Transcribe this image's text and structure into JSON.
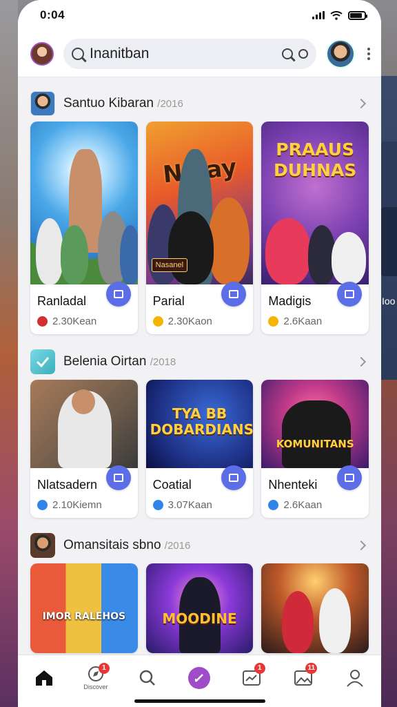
{
  "status": {
    "time": "0:04"
  },
  "header": {
    "search_value": "Inanitban"
  },
  "peek": {
    "text": "Ioo"
  },
  "sections": [
    {
      "title": "Santuo Kibaran",
      "sub": "/2016",
      "cards": [
        {
          "name": "Ranladal",
          "meta": "2.30Kean",
          "dot": "#d32f2f",
          "poster": ""
        },
        {
          "name": "Parial",
          "meta": "2.30Kaon",
          "dot": "#f5b400",
          "poster": "Nalay"
        },
        {
          "name": "Madigis",
          "meta": "2.6Kaan",
          "dot": "#f5b400",
          "poster": "PRAAUS DUHNAS"
        }
      ]
    },
    {
      "title": "Belenia Oirtan",
      "sub": "/2018",
      "cards": [
        {
          "name": "Nlatsadern",
          "meta": "2.10Kiemn",
          "dot": "#2f86e8",
          "poster": ""
        },
        {
          "name": "Coatial",
          "meta": "3.07Kaan",
          "dot": "#2f86e8",
          "poster": "TYA BB DOBARDIANS"
        },
        {
          "name": "Nhenteki",
          "meta": "2.6Kaan",
          "dot": "#2f86e8",
          "poster": "KOMUNITANS"
        }
      ]
    },
    {
      "title": "Omansitais sbno",
      "sub": "/2016",
      "cards": [
        {
          "name": "",
          "meta": "",
          "dot": "",
          "poster": "IMOR RALEHOS"
        },
        {
          "name": "",
          "meta": "",
          "dot": "",
          "poster": "MOODINE"
        },
        {
          "name": "",
          "meta": "",
          "dot": "",
          "poster": ""
        }
      ]
    }
  ],
  "nav": {
    "discover_label": "Discover",
    "discover_badge": "1",
    "alerts_badge": "1",
    "gallery_badge": "11"
  },
  "colors": {
    "accent": "#5b6ee8",
    "create": "#a04cc8",
    "badge": "#e53935"
  }
}
